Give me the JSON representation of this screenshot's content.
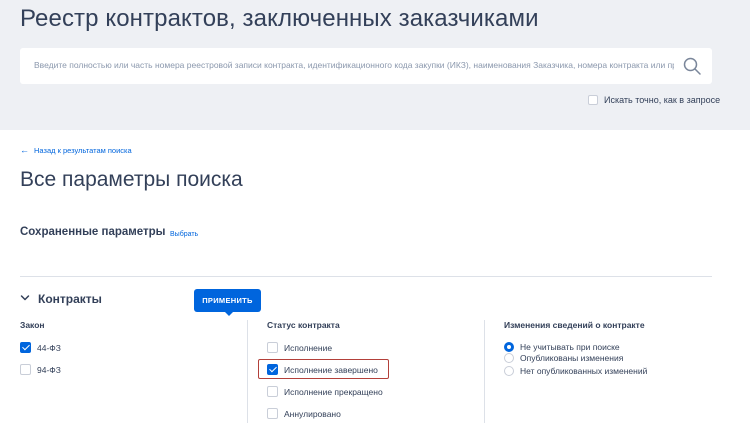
{
  "header": {
    "title": "Реестр контрактов, заключенных заказчиками",
    "search_placeholder": "Введите полностью или часть номера реестровой записи контракта, идентификационного кода закупки (ИКЗ), наименования Заказчика, номера контракта или предме",
    "exact_search_label": "Искать точно, как в запросе",
    "exact_search_checked": false
  },
  "nav": {
    "back_link": "Назад к результатам поиска"
  },
  "main": {
    "title": "Все параметры поиска",
    "saved_params_title": "Сохраненные параметры",
    "saved_params_select": "Выбрать"
  },
  "section": {
    "title": "Контракты",
    "apply_button": "ПРИМЕНИТЬ"
  },
  "law": {
    "heading": "Закон",
    "options": [
      {
        "label": "44-ФЗ",
        "checked": true
      },
      {
        "label": "94-ФЗ",
        "checked": false
      }
    ]
  },
  "status": {
    "heading": "Статус контракта",
    "options": [
      {
        "label": "Исполнение",
        "checked": false
      },
      {
        "label": "Исполнение завершено",
        "checked": true
      },
      {
        "label": "Исполнение прекращено",
        "checked": false
      },
      {
        "label": "Аннулировано",
        "checked": false
      }
    ]
  },
  "changes": {
    "heading": "Изменения сведений о контракте",
    "options": [
      {
        "label": "Не учитывать при поиске",
        "checked": true
      },
      {
        "label": "Опубликованы изменения",
        "checked": false
      },
      {
        "label": "Нет опубликованных изменений",
        "checked": false
      }
    ]
  },
  "colors": {
    "accent": "#0065dd",
    "header_bg": "#eef0f4",
    "highlight_border": "#b3403a"
  }
}
